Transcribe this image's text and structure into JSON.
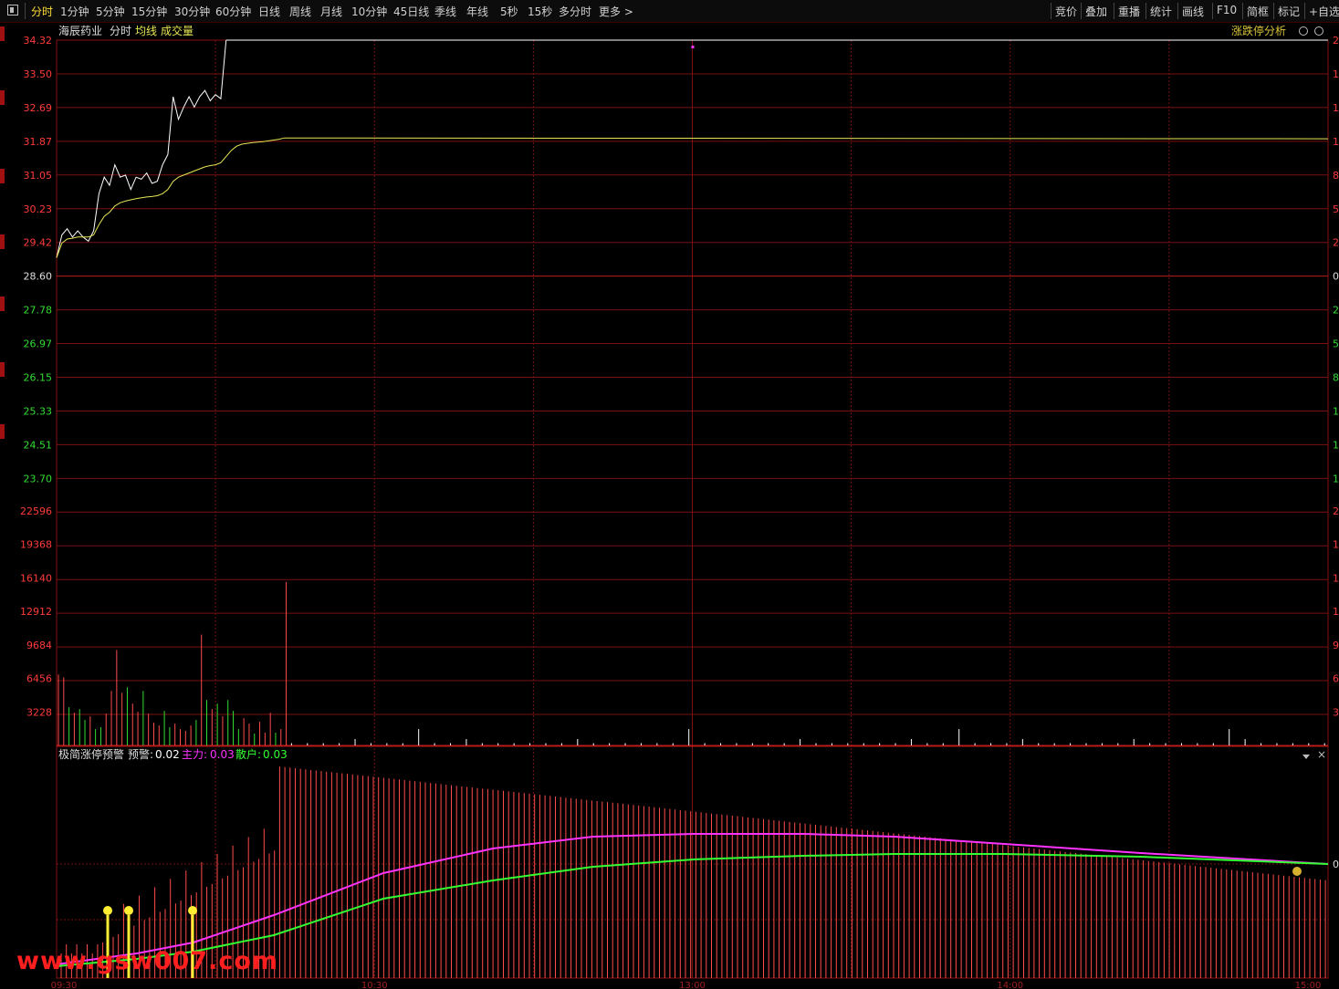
{
  "toolbar": {
    "toggle_icon": "panel-toggle-icon",
    "periods": [
      "分时",
      "1分钟",
      "5分钟",
      "15分钟",
      "30分钟",
      "60分钟",
      "日线",
      "周线",
      "月线",
      "10分钟",
      "45日线",
      "季线",
      "年线",
      "5秒",
      "15秒",
      "多分时",
      "更多 >"
    ],
    "active_period": "分时",
    "tools": [
      "竞价",
      "叠加",
      "重播",
      "统计",
      "画线",
      "F10",
      "简框",
      "标记",
      "+自选"
    ]
  },
  "price_panel": {
    "stock_name": "海辰药业",
    "mode_label": "分时",
    "avg_label": "均线",
    "volume_label": "成交量",
    "limit_analysis_label": "涨跌停分析",
    "price_ticks": [
      "34.32",
      "33.50",
      "32.69",
      "31.87",
      "31.05",
      "30.23",
      "29.42",
      "28.60",
      "27.78",
      "26.97",
      "26.15",
      "25.33",
      "24.51",
      "23.70"
    ],
    "right_ticks_up": [
      "2",
      "1",
      "1",
      "1",
      "8",
      "5",
      "2"
    ],
    "right_ticks_zero": "0",
    "right_ticks_down": [
      "2",
      "5",
      "8",
      "1",
      "1",
      "1",
      "2"
    ],
    "colors": {
      "price_line": "#ffffff",
      "avg_line": "#e6e655",
      "up_axis": "#ff3b3b",
      "down_axis": "#33dd33"
    }
  },
  "volume_panel": {
    "ticks": [
      "22596",
      "19368",
      "16140",
      "12912",
      "9684",
      "6456",
      "3228"
    ],
    "right_ticks": [
      "2",
      "1",
      "1",
      "1",
      "9",
      "6",
      "3"
    ]
  },
  "indicator_panel": {
    "name": "极简涨停预警",
    "alert_label": "预警:",
    "alert_value": "0.02",
    "main_label": "主力:",
    "main_value": "0.03",
    "retail_label": "散户:",
    "retail_value": "0.03",
    "colors": {
      "alert": "#ffffff",
      "main": "#ff33ff",
      "retail": "#33ff33",
      "bars": "#ff4c4c",
      "signal": "#ffee33"
    },
    "right_tick": "0",
    "controls": {
      "collapse_icon": "triangle-down-icon",
      "close_icon": "close-icon"
    },
    "signal_icon": "money-bag-icon"
  },
  "time_axis": [
    "09:30",
    "10:30",
    "13:00",
    "14:00",
    "15:00"
  ],
  "watermark": "www.gsw007.com",
  "chart_data": {
    "type": "line",
    "title": "",
    "xlabel": "",
    "ylabel": "",
    "ylim": [
      23.7,
      34.32
    ],
    "prev_close": 28.6,
    "x_minutes": [
      0,
      1,
      2,
      3,
      4,
      5,
      6,
      7,
      8,
      9,
      10,
      11,
      12,
      13,
      14,
      15,
      16,
      17,
      18,
      19,
      20,
      21,
      22,
      23,
      24,
      25,
      26,
      27,
      28,
      29,
      30,
      31,
      32,
      33,
      34,
      35,
      36,
      37,
      38,
      39,
      40,
      41,
      42,
      43
    ],
    "series": [
      {
        "name": "分时",
        "values": [
          29.05,
          29.6,
          29.75,
          29.55,
          29.7,
          29.55,
          29.45,
          29.7,
          30.6,
          31.0,
          30.8,
          31.3,
          31.0,
          31.05,
          30.7,
          31.0,
          30.95,
          31.1,
          30.85,
          30.9,
          31.3,
          31.55,
          32.95,
          32.4,
          32.7,
          32.95,
          32.7,
          32.95,
          33.1,
          32.85,
          33.0,
          32.9,
          34.32
        ]
      },
      {
        "name": "均线",
        "values": [
          29.05,
          29.4,
          29.5,
          29.52,
          29.55,
          29.55,
          29.55,
          29.6,
          29.85,
          30.05,
          30.15,
          30.3,
          30.38,
          30.42,
          30.45,
          30.48,
          30.5,
          30.52,
          30.53,
          30.55,
          30.6,
          30.7,
          30.9,
          31.0,
          31.05,
          31.1,
          31.15,
          31.2,
          31.25,
          31.28,
          31.3,
          31.35,
          31.5,
          31.65,
          31.75,
          31.8,
          31.82,
          31.84,
          31.85,
          31.86,
          31.88,
          31.9,
          31.92,
          31.95
        ]
      }
    ],
    "avg_tail_end": 31.93,
    "volume": {
      "ylim": [
        0,
        25824
      ],
      "values": [
        7800,
        7500,
        4200,
        3600,
        4000,
        2800,
        3200,
        1800,
        2000,
        3500,
        6000,
        10500,
        5800,
        6400,
        4600,
        3700,
        6000,
        3500,
        2500,
        2200,
        3800,
        2000,
        2400,
        1800,
        1600,
        2200,
        2800,
        12200,
        5000,
        4000,
        4600,
        3200,
        5000,
        3800,
        1800,
        3000,
        2400,
        1300,
        2600,
        1400,
        3600,
        1400,
        1800,
        18000
      ],
      "colors": [
        "up",
        "up",
        "down",
        "up",
        "down",
        "down",
        "up",
        "down",
        "down",
        "up",
        "up",
        "up",
        "up",
        "down",
        "up",
        "up",
        "down",
        "up",
        "up",
        "up",
        "down",
        "down",
        "up",
        "up",
        "up",
        "up",
        "down",
        "up",
        "down",
        "up",
        "down",
        "up",
        "down",
        "down",
        "down",
        "up",
        "up",
        "down",
        "up",
        "up",
        "up",
        "down",
        "up",
        "up"
      ]
    }
  }
}
